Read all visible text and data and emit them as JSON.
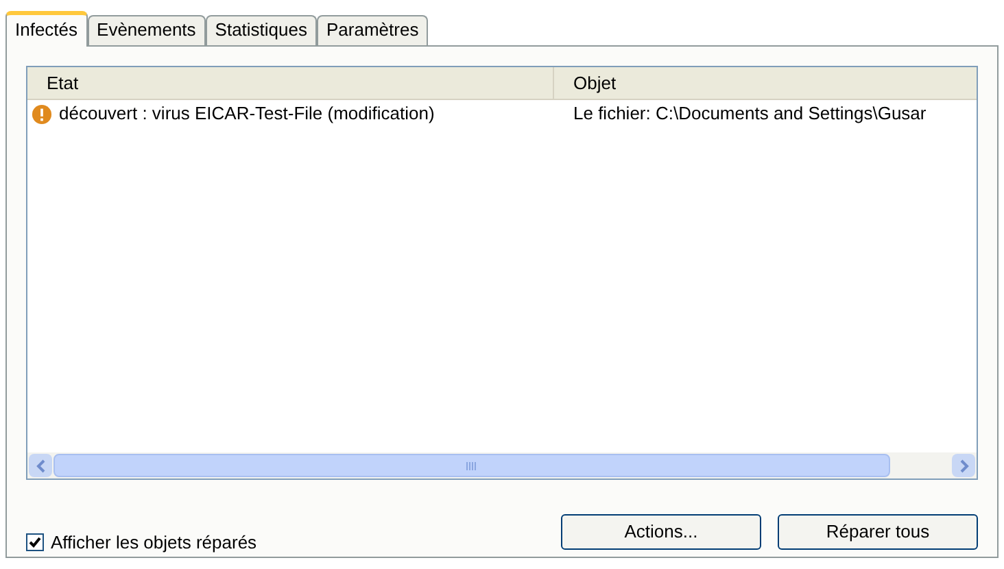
{
  "tabs": [
    {
      "label": "Infectés",
      "selected": true
    },
    {
      "label": "Evènements",
      "selected": false
    },
    {
      "label": "Statistiques",
      "selected": false
    },
    {
      "label": "Paramètres",
      "selected": false
    }
  ],
  "table": {
    "columns": [
      "Etat",
      "Objet"
    ],
    "rows": [
      {
        "kind": "warning",
        "cells": [
          "découvert : virus EICAR-Test-File (modification)",
          "Le fichier: C:\\Documents and Settings\\Gusar"
        ]
      }
    ]
  },
  "show_repaired": {
    "label": "Afficher les objets réparés",
    "checked": true
  },
  "buttons": [
    "Actions...",
    "Réparer tous"
  ]
}
